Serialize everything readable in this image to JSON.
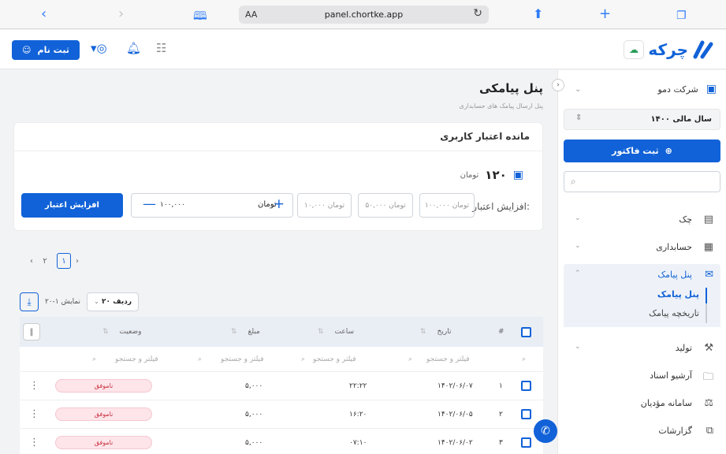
{
  "browser": {
    "url_text": "panel.chortke.app",
    "aa_label": "AA",
    "back_icon": "chevron-left-icon",
    "forward_icon": "chevron-right-icon"
  },
  "header": {
    "signup_label": "ثبت نام",
    "logo_text": "چرکه",
    "brand_color": "#1162d8"
  },
  "sidebar": {
    "company_label": "شرکت دمو",
    "fiscal_year": "سال مالی ۱۴۰۰",
    "invoice_button": "ثبت فاکتور",
    "search_placeholder": "",
    "items": [
      {
        "label": "چک",
        "icon": "check-icon"
      },
      {
        "label": "حسابداری",
        "icon": "calculator-icon"
      },
      {
        "label": "پنل پیامک",
        "icon": "sms-icon"
      },
      {
        "label": "تولید",
        "icon": "tools-icon"
      },
      {
        "label": "آرشیو اسناد",
        "icon": "folder-icon"
      },
      {
        "label": "سامانه مؤدیان",
        "icon": "taxpayer-icon"
      },
      {
        "label": "گزارشات",
        "icon": "reports-icon"
      }
    ],
    "subitems": [
      {
        "label": "پنل پیامک"
      },
      {
        "label": "تاریخچه پیامک"
      }
    ]
  },
  "main": {
    "title": "پنل پیامکی",
    "subtitle": "پنل ارسال پیامک های حسابداری",
    "credit_card": {
      "title": "مانده اعتبار کاربری",
      "balance_amount": "۱۲۰",
      "balance_currency": "تومان",
      "increase_label": "افزایش اعتبار:",
      "chips": [
        "۱۰۰,۰۰۰ تومان",
        "۵۰,۰۰۰ تومان",
        "۱۰,۰۰۰ تومان"
      ],
      "amount_value": "۱۰۰,۰۰۰",
      "amount_currency": "تومان",
      "increase_button": "افزایش اعتبار"
    },
    "pagination": {
      "current": "۱",
      "next": "۲"
    },
    "toolbar": {
      "showing_text": "نمایش ۱-۲۰",
      "rows_select": "ردیف ۲۰"
    },
    "table": {
      "headers": {
        "index": "#",
        "date": "تاریخ",
        "time": "ساعت",
        "amount": "مبلغ",
        "status": "وضعیت"
      },
      "filter_placeholder": "فیلتر و جستجو",
      "rows": [
        {
          "index": "۱",
          "date": "۱۴۰۲/۰۶/۰۷",
          "time": "۲۲:۲۲",
          "amount": "۵,۰۰۰",
          "status": "ناموفق"
        },
        {
          "index": "۲",
          "date": "۱۴۰۲/۰۶/۰۵",
          "time": "۱۶:۲۰",
          "amount": "۵,۰۰۰",
          "status": "ناموفق"
        },
        {
          "index": "۳",
          "date": "۱۴۰۲/۰۶/۰۲",
          "time": "۰۷:۱۰",
          "amount": "۵,۰۰۰",
          "status": "ناموفق"
        }
      ]
    }
  }
}
